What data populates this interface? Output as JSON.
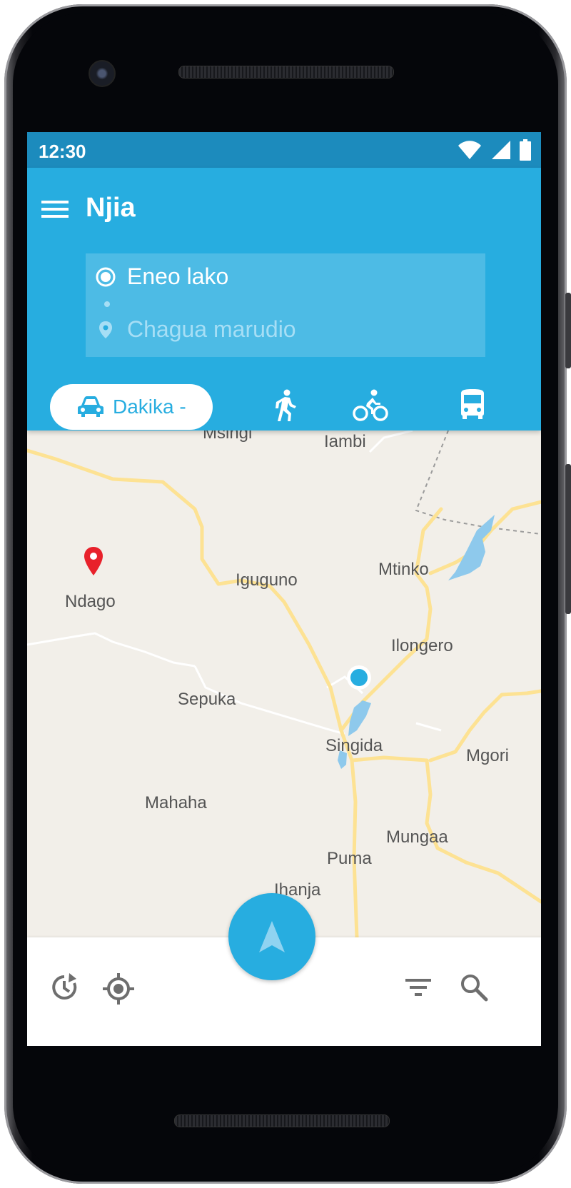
{
  "status_bar": {
    "time": "12:30",
    "icons": [
      "wifi-icon",
      "signal-icon",
      "battery-icon"
    ]
  },
  "app_bar": {
    "title": "Njia",
    "origin_label": "Eneo lako",
    "destination_placeholder": "Chagua marudio"
  },
  "transport_modes": {
    "car_label": "Dakika -",
    "modes": [
      "car",
      "walk",
      "bike",
      "bus"
    ],
    "selected": "car"
  },
  "map": {
    "places": [
      "Msingi",
      "Iambi",
      "Iguguno",
      "Mtinko",
      "Ndago",
      "Ilongero",
      "Sepuka",
      "Singida",
      "Mgori",
      "Mahaha",
      "Mungaa",
      "Puma",
      "Ihanja"
    ],
    "destination_pin": "Ndago",
    "current_location": "Singida"
  },
  "bottom_bar": {
    "left_icons": [
      "history-icon",
      "my-location-icon"
    ],
    "right_icons": [
      "filter-icon",
      "search-icon"
    ],
    "fab": "navigation-icon"
  },
  "colors": {
    "primary": "#27ade0",
    "status_bar": "#1c8bbd",
    "map_background": "#f2efe9",
    "road": "#fde293",
    "water": "#8ec9ec",
    "pin": "#e8212b"
  }
}
